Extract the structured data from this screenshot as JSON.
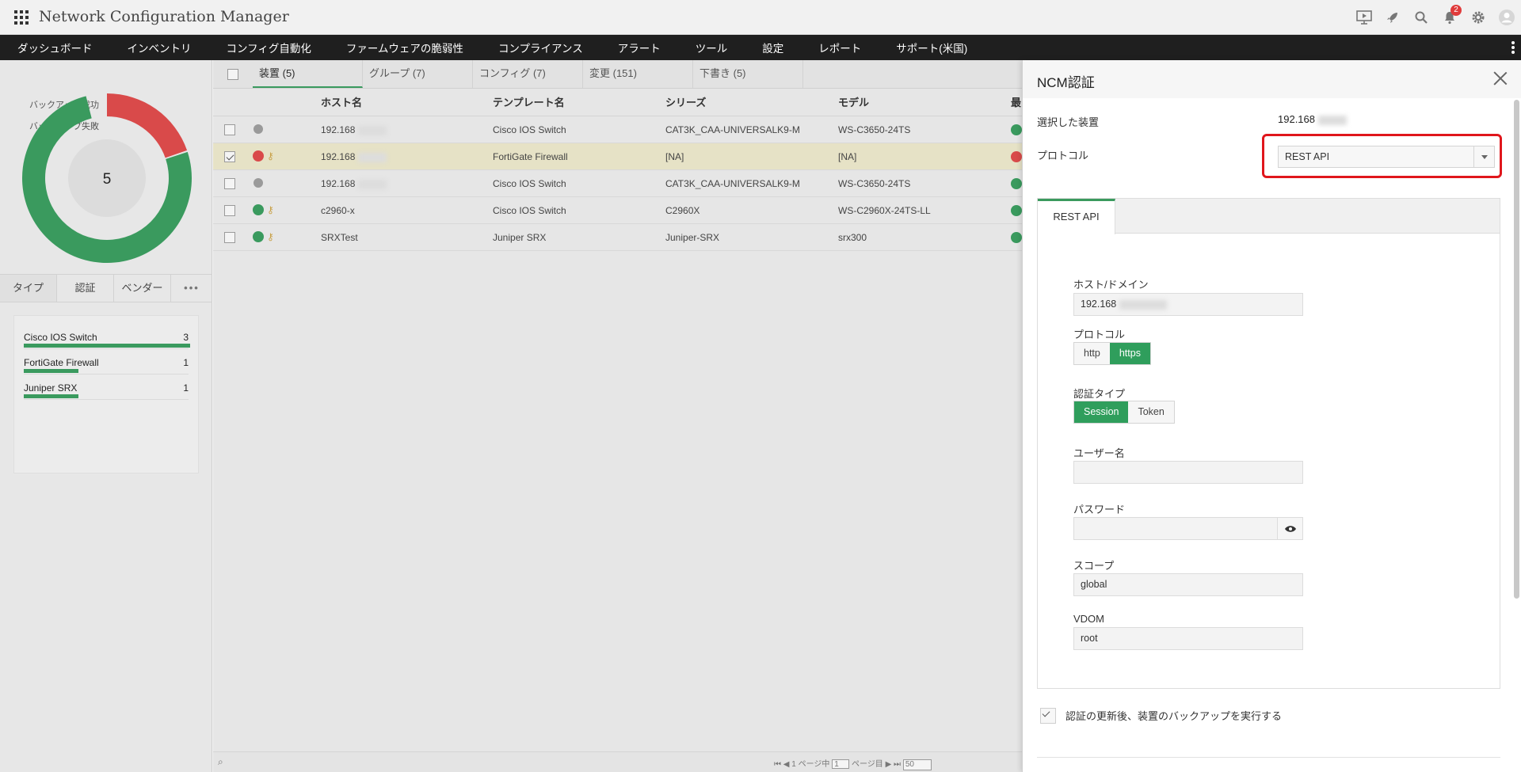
{
  "app": {
    "title": "Network Configuration Manager",
    "notification_count": "2"
  },
  "nav": {
    "items": [
      "ダッシュボード",
      "インベントリ",
      "コンフィグ自動化",
      "ファームウェアの脆弱性",
      "コンプライアンス",
      "アラート",
      "ツール",
      "設定",
      "レポート",
      "サポート(米国)"
    ]
  },
  "summary": {
    "legend_success": "バックアップ成功",
    "legend_fail": "バックアップ失敗",
    "total": "5",
    "chart_data": {
      "type": "pie",
      "categories": [
        "バックアップ成功",
        "バックアップ失敗"
      ],
      "values": [
        4,
        1
      ]
    }
  },
  "left_tabs": [
    "タイプ",
    "認証",
    "ベンダー",
    "•••"
  ],
  "types": [
    {
      "name": "Cisco IOS Switch",
      "count": "3",
      "fraction": 1.0
    },
    {
      "name": "FortiGate Firewall",
      "count": "1",
      "fraction": 0.33
    },
    {
      "name": "Juniper SRX",
      "count": "1",
      "fraction": 0.33
    }
  ],
  "grid": {
    "tabs": [
      "装置 (5)",
      "グループ (7)",
      "コンフィグ (7)",
      "変更 (151)",
      "下書き (5)"
    ],
    "headers": {
      "host": "ホスト名",
      "template": "テンプレート名",
      "series": "シリーズ",
      "model": "モデル",
      "last": "最"
    },
    "rows": [
      {
        "host": "192.168",
        "template": "Cisco IOS Switch",
        "series": "CAT3K_CAA-UNIVERSALK9-M",
        "model": "WS-C3650-24TS"
      },
      {
        "host": "192.168",
        "template": "FortiGate Firewall",
        "series": "[NA]",
        "model": "[NA]"
      },
      {
        "host": "192.168",
        "template": "Cisco IOS Switch",
        "series": "CAT3K_CAA-UNIVERSALK9-M",
        "model": "WS-C3650-24TS"
      },
      {
        "host": "c2960-x",
        "template": "Cisco IOS Switch",
        "series": "C2960X",
        "model": "WS-C2960X-24TS-LL"
      },
      {
        "host": "SRXTest",
        "template": "Juniper SRX",
        "series": "Juniper-SRX",
        "model": "srx300"
      }
    ],
    "pager": {
      "page_text": "1 ページ中",
      "page_value": "1",
      "page_suffix": "ページ目",
      "page_size": "50"
    }
  },
  "panel": {
    "title": "NCM認証",
    "selected_device_label": "選択した装置",
    "selected_device_value": "192.168",
    "protocol_label": "プロトコル",
    "protocol_value": "REST API",
    "tab_label": "REST API",
    "host_label": "ホスト/ドメイン",
    "host_value": "192.168",
    "proto_label": "プロトコル",
    "proto_options": [
      "http",
      "https"
    ],
    "auth_type_label": "認証タイプ",
    "auth_options": [
      "Session",
      "Token"
    ],
    "username_label": "ユーザー名",
    "password_label": "パスワード",
    "scope_label": "スコープ",
    "scope_value": "global",
    "vdom_label": "VDOM",
    "vdom_value": "root",
    "backup_after_label": "認証の更新後、装置のバックアップを実行する"
  },
  "colors": {
    "accent": "#2f9e5c",
    "error": "#d94a4a",
    "highlight": "#e0161c"
  }
}
